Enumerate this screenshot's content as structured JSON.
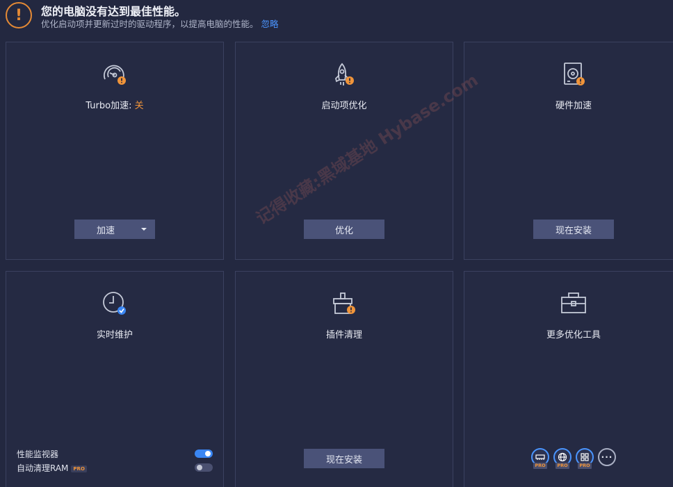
{
  "banner": {
    "icon": "exclamation-icon",
    "title": "您的电脑没有达到最佳性能。",
    "subtitle": "优化启动项并更新过时的驱动程序，以提高电脑的性能。",
    "ignore_link": "忽略"
  },
  "colors": {
    "background": "#232840",
    "tile_border": "#3b4160",
    "button": "#4a5278",
    "warning": "#f0943a",
    "accent_blue": "#3a86f3"
  },
  "tiles": {
    "turbo": {
      "icon": "speedometer-warning-icon",
      "title_prefix": "Turbo加速: ",
      "status": "关",
      "button": "加速"
    },
    "startup": {
      "icon": "rocket-warning-icon",
      "title": "启动项优化",
      "button": "优化"
    },
    "hardware": {
      "icon": "hard-drive-warning-icon",
      "title": "硬件加速",
      "button": "现在安装"
    },
    "realtime": {
      "icon": "clock-check-icon",
      "title": "实时维护",
      "toggles": [
        {
          "label": "性能监视器",
          "on": true,
          "pro": ""
        },
        {
          "label": "自动清理RAM",
          "on": false,
          "pro": "PRO"
        }
      ]
    },
    "plugins": {
      "icon": "plugin-warning-icon",
      "title": "插件清理",
      "button": "现在安装"
    },
    "tools": {
      "icon": "toolbox-icon",
      "title": "更多优化工具",
      "items": [
        {
          "icon": "ram-icon",
          "badge": "PRO"
        },
        {
          "icon": "globe-icon",
          "badge": "PRO"
        },
        {
          "icon": "grid-apps-icon",
          "badge": "PRO"
        }
      ],
      "more": "···"
    }
  },
  "watermark": "记得收藏:黑域基地  Hybase.com"
}
